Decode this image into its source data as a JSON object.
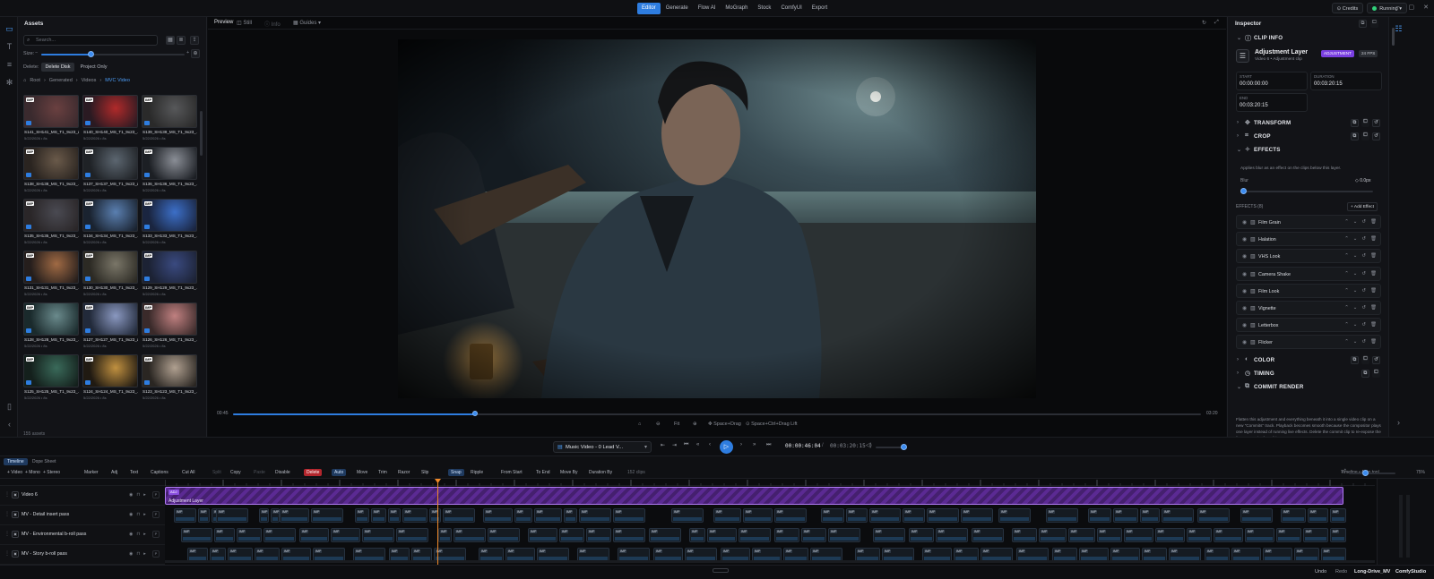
{
  "topbar": {
    "tabs": [
      "Editor",
      "Generate",
      "Flow AI",
      "MoGraph",
      "Stock",
      "ComfyUI",
      "Export"
    ],
    "active_tab": "Editor",
    "credits_label": "Credits",
    "status_label": "Running",
    "status_color": "#31d07a",
    "accent": "#2e7de0"
  },
  "assets": {
    "title": "Assets",
    "search_placeholder": "Search...",
    "size_label": "Size:",
    "delete_label": "Delete:",
    "delete_options": [
      "Delete Disk",
      "Project Only"
    ],
    "breadcrumbs": [
      "Root",
      "Generated",
      "Videos",
      "MVC Video"
    ],
    "count_label": "155 assets",
    "items": [
      {
        "name": "S141_SH141_MS_T1_9x23_a...",
        "meta": "5/22/2026 • 8s",
        "tag": "IMP"
      },
      {
        "name": "S140_SH140_MS_T1_9x23_...",
        "meta": "5/22/2026 • 8s",
        "tag": "IMP"
      },
      {
        "name": "S139_SH139_MS_T1_9x23_...",
        "meta": "5/22/2026 • 8s",
        "tag": "IMP"
      },
      {
        "name": "S138_SH138_MS_T1_9x23_...",
        "meta": "5/22/2026 • 8s",
        "tag": "IMP"
      },
      {
        "name": "S137_SH137_MS_T1_9x23_a...",
        "meta": "5/22/2026 • 8s",
        "tag": "IMP"
      },
      {
        "name": "S136_SH136_MS_T1_9x23_...",
        "meta": "5/22/2026 • 8s",
        "tag": "IMP"
      },
      {
        "name": "S135_SH135_MS_T1_9x23_...",
        "meta": "5/22/2026 • 8s",
        "tag": "IMP"
      },
      {
        "name": "S134_SH134_MS_T1_9x23_...",
        "meta": "5/22/2026 • 8s",
        "tag": "IMP"
      },
      {
        "name": "S133_SH133_MS_T1_9x23_...",
        "meta": "5/22/2026 • 8s",
        "tag": "IMP"
      },
      {
        "name": "S131_SH131_MS_T1_9x23_...",
        "meta": "5/22/2026 • 8s",
        "tag": "IMP"
      },
      {
        "name": "S130_SH130_MS_T1_9x23_...",
        "meta": "5/22/2026 • 8s",
        "tag": "IMP"
      },
      {
        "name": "S129_SH129_MS_T1_9x23_...",
        "meta": "5/22/2026 • 8s",
        "tag": "IMP"
      },
      {
        "name": "S128_SH128_MS_T1_9x23_...",
        "meta": "5/22/2026 • 8s",
        "tag": "IMP"
      },
      {
        "name": "S127_SH127_MS_T1_9x23_a...",
        "meta": "5/22/2026 • 8s",
        "tag": "IMP"
      },
      {
        "name": "S126_SH126_MS_T1_9x23_...",
        "meta": "5/22/2026 • 8s",
        "tag": "IMP"
      },
      {
        "name": "S125_SH125_MS_T1_9x23_...",
        "meta": "5/22/2026 • 8s",
        "tag": "IMP"
      },
      {
        "name": "S124_SH124_MS_T1_9x23_...",
        "meta": "5/22/2026 • 8s",
        "tag": "IMP"
      },
      {
        "name": "S123_SH123_MS_T1_9x23_...",
        "meta": "5/22/2026 • 8s",
        "tag": "IMP"
      }
    ]
  },
  "preview": {
    "tabs": [
      "Preview",
      "Still",
      "Info",
      "Guides"
    ],
    "time_start": "00:45",
    "time_end": "03:20",
    "progress_fraction": 0.25,
    "fit_label": "Fit",
    "hint_pan": "Space+Drag",
    "hint_lift": "Space+Ctrl+Drag Lift"
  },
  "inspector": {
    "title": "Inspector",
    "sections": {
      "clip_info": "CLIP INFO",
      "transform": "TRANSFORM",
      "crop": "CROP",
      "effects": "EFFECTS",
      "color": "COLOR",
      "timing": "TIMING",
      "commit": "COMMIT RENDER"
    },
    "clip": {
      "name": "Adjustment Layer",
      "subtitle": "Video 6 • Adjustment clip",
      "badge_type": "ADJUSTMENT",
      "badge_fps": "24 FPS",
      "badge_type_color": "#7a3fe0",
      "start_label": "START",
      "start_value": "00:00:00:00",
      "duration_label": "DURATION",
      "duration_value": "00:03:20:15",
      "end_label": "END",
      "end_value": "00:03:20:15"
    },
    "effects_desc": "Applies blur as an effect on the clips below this layer.",
    "blur_label": "Blur",
    "blur_value": "0.0px",
    "effects_count_label": "EFFECTS (8)",
    "add_effect_label": "+ Add Effect",
    "effects": [
      "Film Grain",
      "Halation",
      "VHS Look",
      "Camera Shake",
      "Film Look",
      "Vignette",
      "Letterbox",
      "Flicker"
    ],
    "commit_desc": "Flatten this adjustment and everything beneath it into a single video clip on a new \"Commits\" track. Playback becomes smooth because the compositor plays one layer instead of running live effects. Delete the commit clip to re-expose the live composite for editing."
  },
  "transport": {
    "project": "Music Video - 0 Lead V...",
    "timecode": "00:00:46:04",
    "total": "00:03:20:15"
  },
  "timeline_tabs": [
    "Timeline",
    "Dope Sheet"
  ],
  "toolbar": {
    "items": [
      "+ Video",
      "+ Mono",
      "+ Stereo",
      "Marker",
      "Adj",
      "Text",
      "Captions",
      "Cut All",
      "Split",
      "Copy",
      "Paste",
      "Disable",
      "Delete",
      "Auto",
      "Move",
      "Trim",
      "Razor",
      "Slip",
      "Snap",
      "Ripple",
      "From Start",
      "To End",
      "Move By",
      "Duration By",
      "152 clips"
    ],
    "right_label": "Timeline • Auto tool",
    "zoom": "75%"
  },
  "tracks": [
    {
      "name": "Video 6",
      "type": "adjustment"
    },
    {
      "name": "MV - Detail insert pass",
      "type": "video"
    },
    {
      "name": "MV - Environmental b-roll pass",
      "type": "video"
    },
    {
      "name": "MV - Story b-roll pass",
      "type": "video"
    }
  ],
  "adjustment_clip": {
    "label": "Adjustment Layer",
    "marker": "ADJ"
  },
  "clip_tag": "IMP",
  "status": {
    "undo": "Undo",
    "redo": "Redo",
    "project": "Long-Drive_MV",
    "app": "ComfyStudio"
  }
}
